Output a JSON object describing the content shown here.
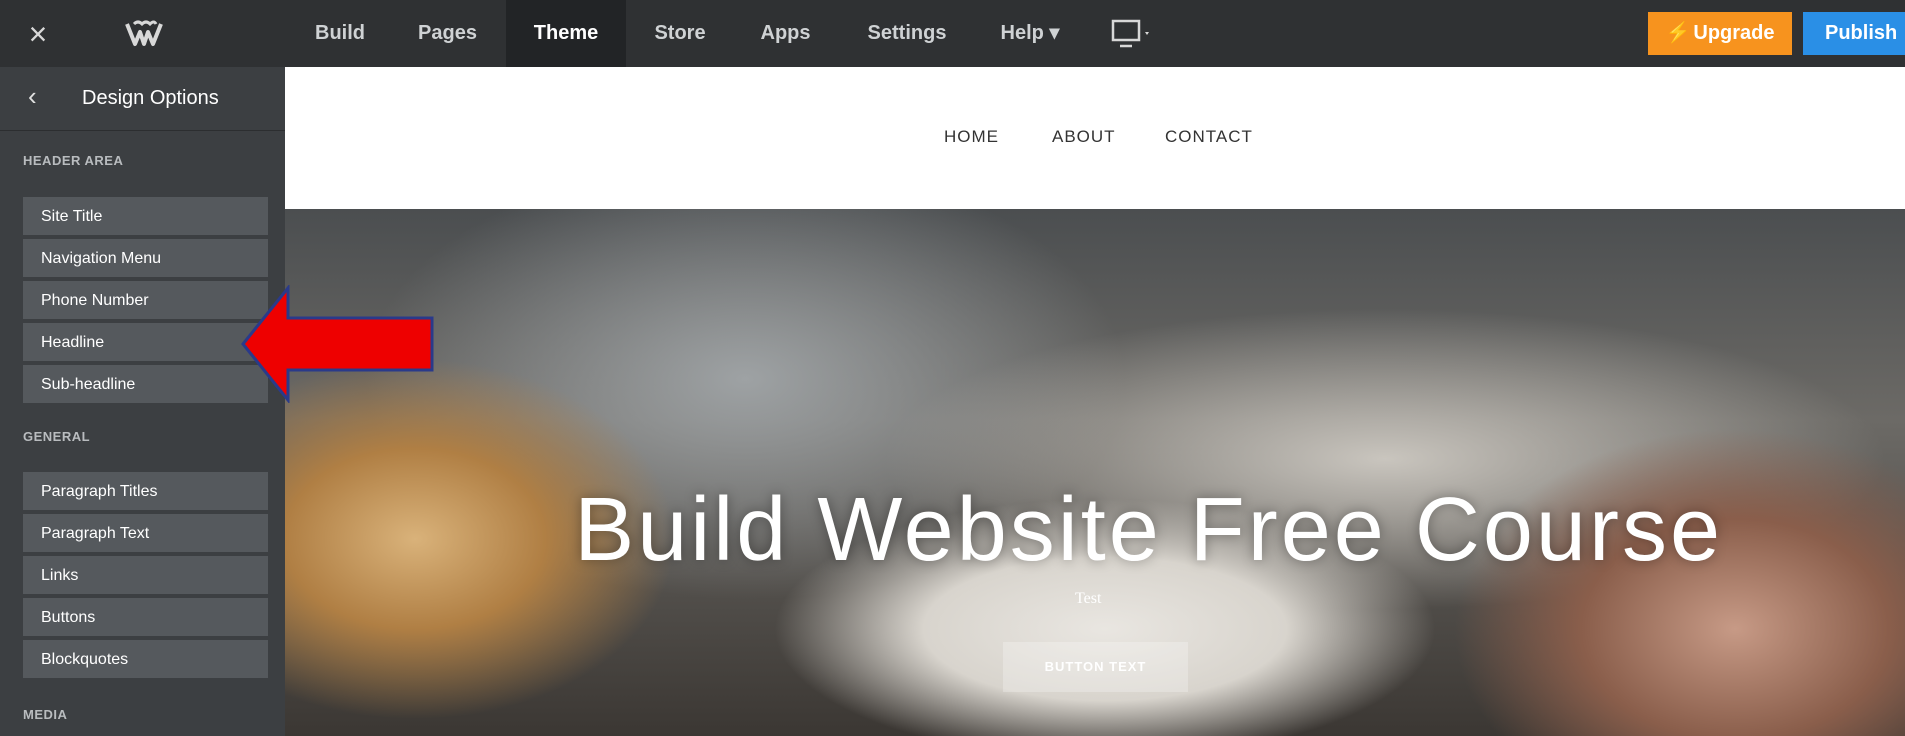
{
  "topbar": {
    "close_icon": "close-icon",
    "logo_icon": "weebly-logo-icon",
    "tabs": [
      {
        "label": "Build"
      },
      {
        "label": "Pages"
      },
      {
        "label": "Theme",
        "active": true
      },
      {
        "label": "Store"
      },
      {
        "label": "Apps"
      },
      {
        "label": "Settings"
      },
      {
        "label": "Help ▾"
      }
    ],
    "device_icon": "desktop-icon",
    "upgrade_label": "Upgrade",
    "publish_label": "Publish",
    "colors": {
      "bar": "#2f3133",
      "upgrade": "#f7931e",
      "publish": "#2a8fe6"
    }
  },
  "sidebar": {
    "title": "Design Options",
    "back_icon": "chevron-left-icon",
    "sections": [
      {
        "label": "HEADER AREA",
        "items": [
          "Site Title",
          "Navigation Menu",
          "Phone Number",
          "Headline",
          "Sub-headline"
        ]
      },
      {
        "label": "GENERAL",
        "items": [
          "Paragraph Titles",
          "Paragraph Text",
          "Links",
          "Buttons",
          "Blockquotes"
        ]
      },
      {
        "label": "MEDIA",
        "items": []
      }
    ]
  },
  "preview": {
    "nav_links": [
      "HOME",
      "ABOUT",
      "CONTACT"
    ],
    "headline": "Build Website Free Course",
    "subheadline": "Test",
    "button_text": "BUTTON TEXT"
  },
  "annotation": {
    "arrow_color": "#ee0000"
  }
}
